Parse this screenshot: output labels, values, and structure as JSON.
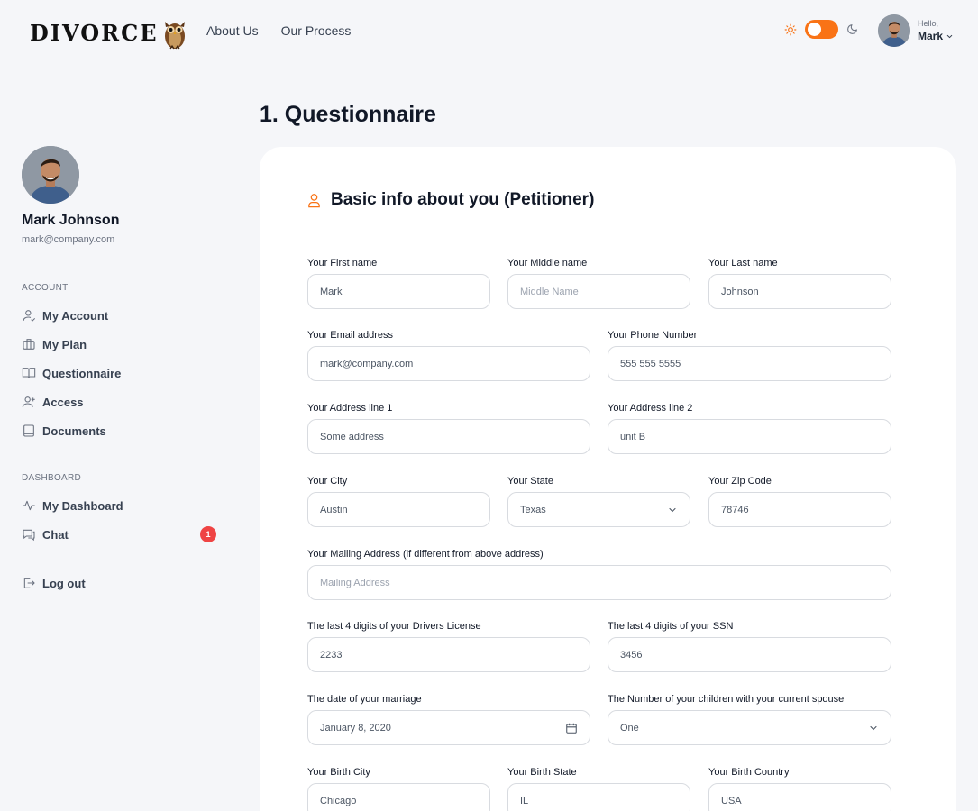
{
  "header": {
    "logo": "DIVORCE",
    "nav": [
      "About Us",
      "Our Process"
    ],
    "hello": "Hello,",
    "user_name": "Mark"
  },
  "sidebar": {
    "name": "Mark Johnson",
    "email": "mark@company.com",
    "account_section": "ACCOUNT",
    "account_items": [
      {
        "label": "My Account",
        "icon": "user-icon"
      },
      {
        "label": "My Plan",
        "icon": "briefcase-icon"
      },
      {
        "label": "Questionnaire",
        "icon": "book-icon"
      },
      {
        "label": "Access",
        "icon": "user-plus-icon"
      },
      {
        "label": "Documents",
        "icon": "document-icon"
      }
    ],
    "dashboard_section": "DASHBOARD",
    "dashboard_items": [
      {
        "label": "My Dashboard",
        "icon": "activity-icon"
      },
      {
        "label": "Chat",
        "icon": "chat-icon",
        "badge": "1"
      }
    ],
    "logout": "Log out"
  },
  "main": {
    "title": "1. Questionnaire",
    "section_title": "Basic info about you (Petitioner)",
    "fields": {
      "first_name": {
        "label": "Your First name",
        "value": "Mark"
      },
      "middle_name": {
        "label": "Your Middle name",
        "placeholder": "Middle Name"
      },
      "last_name": {
        "label": "Your Last name",
        "value": "Johnson"
      },
      "email": {
        "label": "Your Email address",
        "value": "mark@company.com"
      },
      "phone": {
        "label": "Your Phone Number",
        "value": "555 555 5555"
      },
      "address1": {
        "label": "Your Address line 1",
        "value": "Some address"
      },
      "address2": {
        "label": "Your Address line 2",
        "value": "unit B"
      },
      "city": {
        "label": "Your City",
        "value": "Austin"
      },
      "state": {
        "label": "Your State",
        "value": "Texas"
      },
      "zip": {
        "label": "Your Zip Code",
        "value": "78746"
      },
      "mailing": {
        "label": "Your Mailing Address (if different from above address)",
        "placeholder": "Mailing Address"
      },
      "license": {
        "label": "The last 4 digits of your Drivers License",
        "value": "2233"
      },
      "ssn": {
        "label": "The last 4 digits of your SSN",
        "value": "3456"
      },
      "marriage_date": {
        "label": "The date of your marriage",
        "value": "January 8, 2020"
      },
      "children": {
        "label": "The Number of your children with your current spouse",
        "value": "One"
      },
      "birth_city": {
        "label": "Your Birth City",
        "value": "Chicago"
      },
      "birth_state": {
        "label": "Your Birth State",
        "value": "IL"
      },
      "birth_country": {
        "label": "Your Birth Country",
        "value": "USA"
      }
    }
  },
  "colors": {
    "accent": "#f97316",
    "badge": "#ef4444",
    "background": "#f5f6f9"
  }
}
